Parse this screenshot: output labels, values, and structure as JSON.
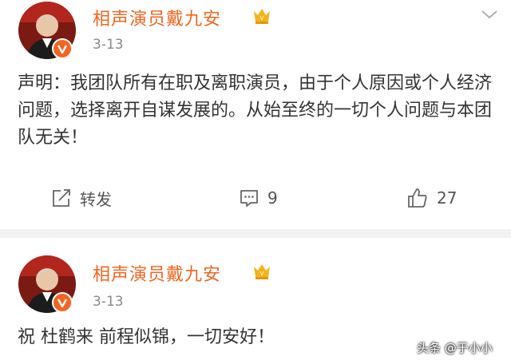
{
  "posts": [
    {
      "author": "相声演员戴九安",
      "time": "3-13",
      "text": "声明：我团队所有在职及离职演员，由于个人原因或个人经济问题，选择离开自谋发展的。从始至终的一切个人问题与本团队无关！",
      "actions": {
        "repost_label": "转发",
        "comment_count": "9",
        "like_count": "27"
      }
    },
    {
      "author": "相声演员戴九安",
      "time": "3-13",
      "text": "祝 杜鹤来 前程似锦，一切安好！"
    }
  ],
  "watermark": "头条 @于小小",
  "icons": {
    "verified": "verified-v-icon",
    "member": "vip-crown-icon",
    "menu": "chevron-down-icon",
    "repost": "repost-icon",
    "comment": "comment-icon",
    "like": "thumbs-up-icon"
  },
  "colors": {
    "name": "#f26522",
    "badge": "#f26522",
    "crown": "#f5b31a",
    "text": "#333333",
    "meta": "#888888",
    "divider": "#f2f2f2"
  }
}
